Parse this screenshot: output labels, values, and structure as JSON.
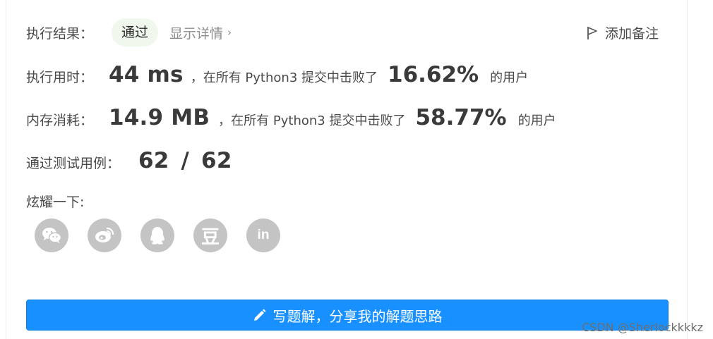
{
  "result": {
    "label": "执行结果：",
    "status": "通过",
    "details": "显示详情",
    "add_note": "添加备注"
  },
  "runtime": {
    "label": "执行用时：",
    "value": "44 ms",
    "mid": "，在所有 Python3 提交中击败了",
    "pct": "16.62%",
    "tail": "的用户"
  },
  "memory": {
    "label": "内存消耗：",
    "value": "14.9 MB",
    "mid": "，在所有 Python3 提交中击败了",
    "pct": "58.77%",
    "tail": "的用户"
  },
  "testcases": {
    "label": "通过测试用例：",
    "value": "62 / 62"
  },
  "share": {
    "label": "炫耀一下:",
    "icons": [
      "wechat-icon",
      "weibo-icon",
      "qq-icon",
      "douban-icon",
      "linkedin-icon"
    ],
    "douban_glyph": "豆",
    "linkedin_glyph": "in"
  },
  "cta": {
    "label": "写题解，分享我的解题思路"
  },
  "watermark": "CSDN @Sherlockkkkz",
  "colors": {
    "primary": "#1890ff",
    "badge_bg": "#f0f7ed",
    "icon_gray": "#c4c4c4"
  }
}
